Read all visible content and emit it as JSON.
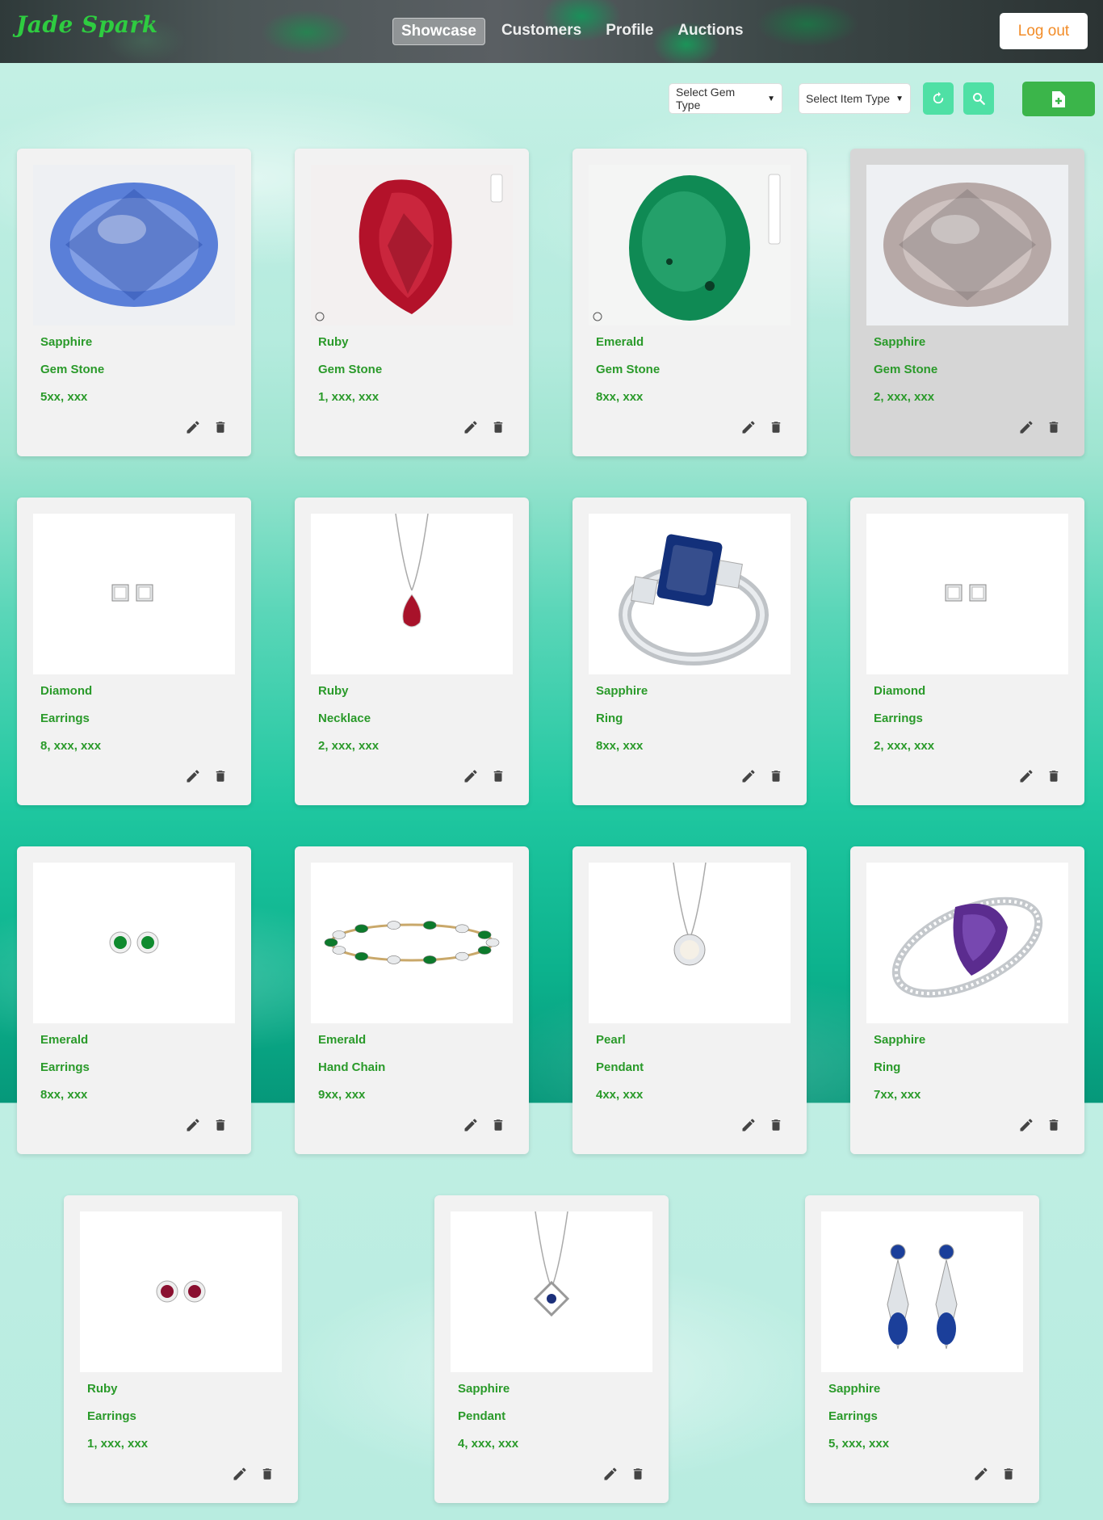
{
  "header": {
    "logo": "Jade Spark",
    "nav": [
      "Showcase",
      "Customers",
      "Profile",
      "Auctions"
    ],
    "active_nav": "Showcase",
    "logout": "Log out"
  },
  "toolbar": {
    "gem_type_select": "Select Gem Type",
    "item_type_select": "Select Item Type",
    "refresh_icon": "refresh-icon",
    "search_icon": "search-icon",
    "add_icon": "add-file-icon"
  },
  "colors": {
    "brand_green": "#2ecc40",
    "text_green": "#2a9a2a",
    "logout_orange": "#f28c28",
    "mint_button": "#4fe0a5",
    "add_button": "#3bb54a"
  },
  "cards": [
    {
      "gem": "Sapphire",
      "type": "Gem Stone",
      "price": "5xx, xxx"
    },
    {
      "gem": "Ruby",
      "type": "Gem Stone",
      "price": "1, xxx, xxx"
    },
    {
      "gem": "Emerald",
      "type": "Gem Stone",
      "price": "8xx, xxx"
    },
    {
      "gem": "Sapphire",
      "type": "Gem Stone",
      "price": "2, xxx, xxx"
    },
    {
      "gem": "Diamond",
      "type": "Earrings",
      "price": "8, xxx, xxx"
    },
    {
      "gem": "Ruby",
      "type": "Necklace",
      "price": "2, xxx, xxx"
    },
    {
      "gem": "Sapphire",
      "type": "Ring",
      "price": "8xx, xxx"
    },
    {
      "gem": "Diamond",
      "type": "Earrings",
      "price": "2, xxx, xxx"
    },
    {
      "gem": "Emerald",
      "type": "Earrings",
      "price": "8xx, xxx"
    },
    {
      "gem": "Emerald",
      "type": "Hand Chain",
      "price": "9xx, xxx"
    },
    {
      "gem": "Pearl",
      "type": "Pendant",
      "price": "4xx, xxx"
    },
    {
      "gem": "Sapphire",
      "type": "Ring",
      "price": "7xx, xxx"
    },
    {
      "gem": "Ruby",
      "type": "Earrings",
      "price": "1, xxx, xxx"
    },
    {
      "gem": "Sapphire",
      "type": "Pendant",
      "price": "4, xxx, xxx"
    },
    {
      "gem": "Sapphire",
      "type": "Earrings",
      "price": "5, xxx, xxx"
    }
  ]
}
